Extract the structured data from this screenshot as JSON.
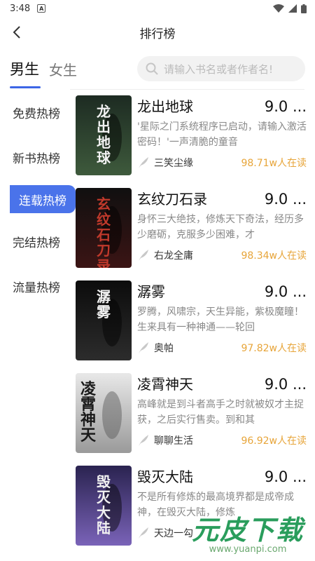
{
  "status": {
    "time": "3:48"
  },
  "header": {
    "title": "排行榜"
  },
  "gender_tabs": [
    "男生",
    "女生"
  ],
  "search": {
    "placeholder": "请输入书名或者作者名!"
  },
  "sidebar": {
    "items": [
      "免费热榜",
      "新书热榜",
      "连载热榜",
      "完结热榜",
      "流量热榜"
    ],
    "active_index": 2
  },
  "books": [
    {
      "title": "龙出地球",
      "score": "9.0 ...",
      "desc": "'星际之门系统程序已启动，请输入激活密码！'一声清脆的童音",
      "author": "三笑尘缘",
      "readers": "98.71w人在读",
      "cover_text": "龙出地球",
      "cover_colors": [
        "#1d2b22",
        "#3e5a3c"
      ]
    },
    {
      "title": "玄纹刀石录",
      "score": "9.0 ...",
      "desc": "身怀三大绝技，修炼天下奇法，经历多少磨砺，克服多少困难，才",
      "author": "右龙全庸",
      "readers": "98.34w人在读",
      "cover_text": "玄纹石刀录",
      "cover_colors": [
        "#101010",
        "#3b1414"
      ]
    },
    {
      "title": "潺雾",
      "score": "9.0 ...",
      "desc": "罗腾，风啸宗，天生异能，紫极魔瞳！生来具有一种神通——轮回",
      "author": "奥帕",
      "readers": "97.82w人在读",
      "cover_text": "潺雾",
      "cover_colors": [
        "#0c0c0c",
        "#2c2c2c"
      ]
    },
    {
      "title": "凌霄神天",
      "score": "9.0 ...",
      "desc": "高峰就是到斗者高手之时就被奴才主捉获，之后实行售卖。到和其",
      "author": "聊聊生活",
      "readers": "96.92w人在读",
      "cover_text": "凌霄神天",
      "cover_colors": [
        "#e8e8e8",
        "#9a9a9a"
      ]
    },
    {
      "title": "毁灭大陆",
      "score": "9.0 ...",
      "desc": "不是所有修炼的最高境界都是成帝成神，在毁灭大陆，修炼",
      "author": "天边一勾",
      "readers": "",
      "cover_text": "毁灭大陆",
      "cover_colors": [
        "#2a2350",
        "#7a63b8"
      ]
    }
  ],
  "watermark": {
    "main": "元皮下载",
    "sub": "www.yuanpi.com"
  }
}
